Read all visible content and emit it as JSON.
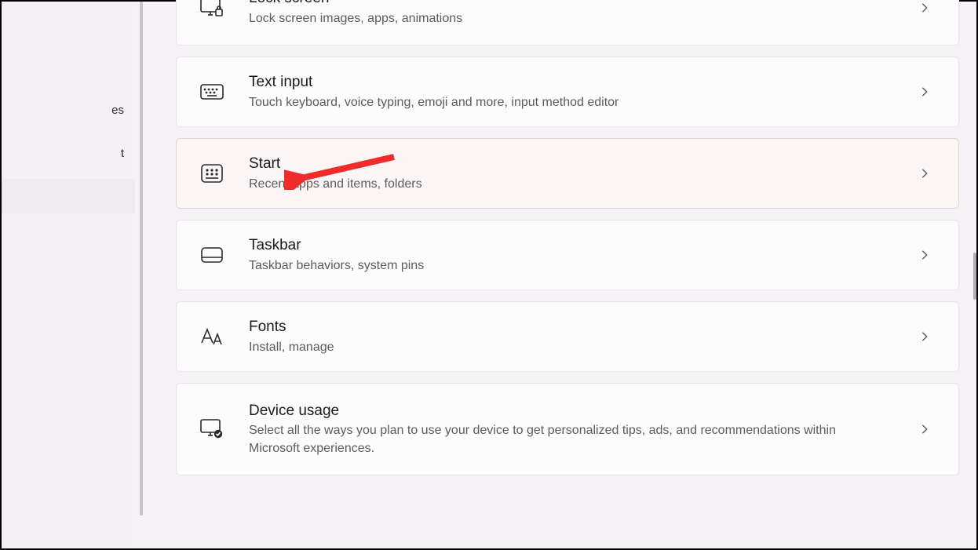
{
  "sidebar": {
    "item_a": "es",
    "item_b": "t"
  },
  "items": [
    {
      "title": "Lock screen",
      "sub": "Lock screen images, apps, animations"
    },
    {
      "title": "Text input",
      "sub": "Touch keyboard, voice typing, emoji and more, input method editor"
    },
    {
      "title": "Start",
      "sub": "Recent apps and items, folders"
    },
    {
      "title": "Taskbar",
      "sub": "Taskbar behaviors, system pins"
    },
    {
      "title": "Fonts",
      "sub": "Install, manage"
    },
    {
      "title": "Device usage",
      "sub": "Select all the ways you plan to use your device to get personalized tips, ads, and recommendations within Microsoft experiences."
    }
  ]
}
